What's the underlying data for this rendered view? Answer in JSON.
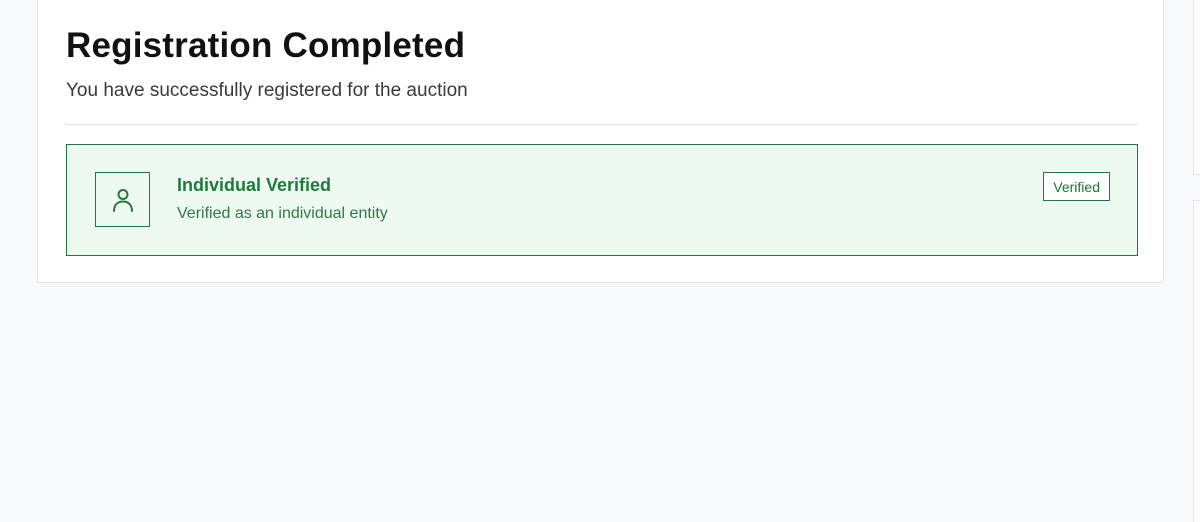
{
  "registration": {
    "title": "Registration Completed",
    "subtitle": "You have successfully registered for the auction"
  },
  "verification": {
    "icon": "user-icon",
    "title": "Individual Verified",
    "description": "Verified as an individual entity",
    "badge_label": "Verified",
    "accent_color": "#1f7a3d",
    "background_color": "#eefaf1"
  }
}
